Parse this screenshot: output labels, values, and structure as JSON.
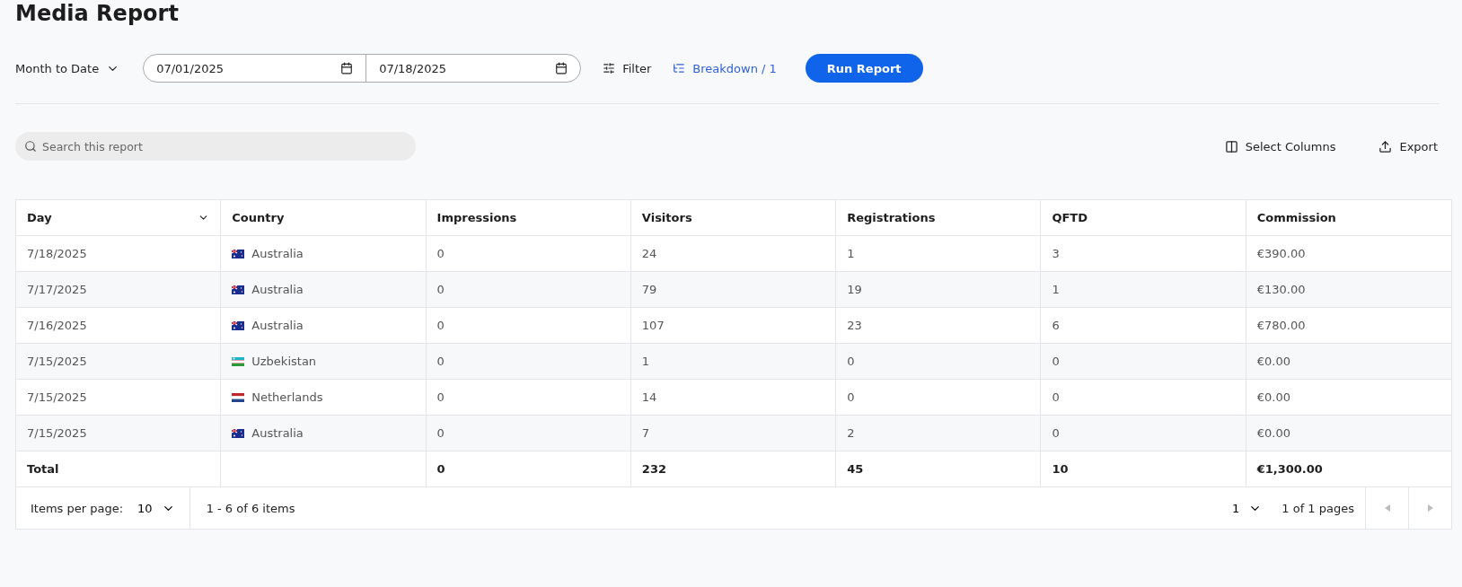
{
  "title": "Media Report",
  "toolbar": {
    "range": "Month to Date",
    "date_from": "07/01/2025",
    "date_to": "07/18/2025",
    "filter": "Filter",
    "breakdown": "Breakdown / 1",
    "run": "Run Report"
  },
  "search": {
    "placeholder": "Search this report"
  },
  "actions": [
    "Select Columns",
    "Export"
  ],
  "table": {
    "columns": [
      "Day",
      "Country",
      "Impressions",
      "Visitors",
      "Registrations",
      "QFTD",
      "Commission"
    ],
    "rows": [
      {
        "kind": "australia",
        "cells": [
          "7/18/2025",
          "Australia",
          "0",
          "24",
          "1",
          "3",
          "€390.00"
        ]
      },
      {
        "kind": "australia",
        "cells": [
          "7/17/2025",
          "Australia",
          "0",
          "79",
          "19",
          "1",
          "€130.00"
        ]
      },
      {
        "kind": "australia",
        "cells": [
          "7/16/2025",
          "Australia",
          "0",
          "107",
          "23",
          "6",
          "€780.00"
        ]
      },
      {
        "kind": "uzbekistan",
        "cells": [
          "7/15/2025",
          "Uzbekistan",
          "0",
          "1",
          "0",
          "0",
          "€0.00"
        ]
      },
      {
        "kind": "netherlands",
        "cells": [
          "7/15/2025",
          "Netherlands",
          "0",
          "14",
          "0",
          "0",
          "€0.00"
        ]
      },
      {
        "kind": "australia",
        "cells": [
          "7/15/2025",
          "Australia",
          "0",
          "7",
          "2",
          "0",
          "€0.00"
        ]
      }
    ],
    "total": {
      "cells": [
        "Total",
        "",
        "0",
        "232",
        "45",
        "10",
        "€1,300.00"
      ]
    }
  },
  "pager": {
    "items_label": "Items per page:",
    "per_page": "10",
    "range": "1 - 6 of 6 items",
    "page": "1",
    "pages": "1 of 1 pages",
    "prev_disabled": true,
    "next_disabled": true
  }
}
